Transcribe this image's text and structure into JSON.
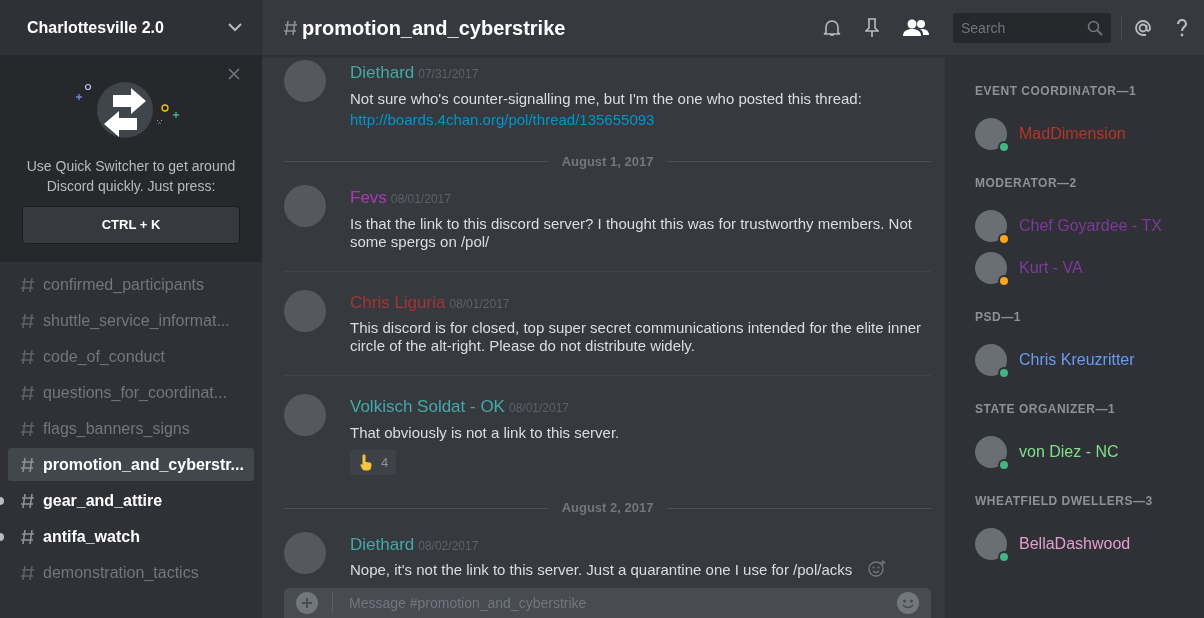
{
  "server": {
    "name": "Charlottesville 2.0"
  },
  "quick_switcher": {
    "text": "Use Quick Switcher to get around Discord quickly. Just press:",
    "shortcut": "CTRL + K"
  },
  "channels": [
    {
      "name": "confirmed_participants",
      "selected": false,
      "unread": false
    },
    {
      "name": "shuttle_service_informat...",
      "selected": false,
      "unread": false
    },
    {
      "name": "code_of_conduct",
      "selected": false,
      "unread": false
    },
    {
      "name": "questions_for_coordinat...",
      "selected": false,
      "unread": false
    },
    {
      "name": "flags_banners_signs",
      "selected": false,
      "unread": false
    },
    {
      "name": "promotion_and_cyberstr...",
      "selected": true,
      "unread": false
    },
    {
      "name": "gear_and_attire",
      "selected": false,
      "unread": true
    },
    {
      "name": "antifa_watch",
      "selected": false,
      "unread": true
    },
    {
      "name": "demonstration_tactics",
      "selected": false,
      "unread": false
    }
  ],
  "channel_header": {
    "name": "promotion_and_cyberstrike"
  },
  "search": {
    "placeholder": "Search"
  },
  "feed": [
    {
      "kind": "message",
      "author": "Diethard",
      "color": "#43a9a9",
      "timestamp": "07/31/2017",
      "text": "Not sure who's counter-signalling me, but I'm the one who posted this thread:",
      "link": "http://boards.4chan.org/pol/thread/135655093"
    },
    {
      "kind": "divider",
      "date": "August 1, 2017"
    },
    {
      "kind": "message",
      "author": "Fevs",
      "color": "#a83bb5",
      "timestamp": "08/01/2017",
      "text": "Is that the link to this discord server? I thought this was for trustworthy members. Not some spergs on /pol/"
    },
    {
      "kind": "message",
      "author": "Chris Liguria",
      "color": "#a23636",
      "timestamp": "08/01/2017",
      "text": "This discord is for closed, top super secret communications intended for the elite inner circle of the alt-right. Please do not distribute widely."
    },
    {
      "kind": "message",
      "author": "Volkisch Soldat - OK",
      "color": "#43a9a9",
      "timestamp": "08/01/2017",
      "text": "That obviously is not a link to this server.",
      "reaction": {
        "count": "4"
      }
    },
    {
      "kind": "divider",
      "date": "August 2, 2017"
    },
    {
      "kind": "message",
      "author": "Diethard",
      "color": "#43a9a9",
      "timestamp": "08/02/2017",
      "text": "Nope, it's not the link to this server. Just a quarantine one I use for /pol/acks",
      "hovered": true
    }
  ],
  "composer": {
    "placeholder": "Message #promotion_and_cyberstrike"
  },
  "members": [
    {
      "heading": "EVENT COORDINATOR—1",
      "items": [
        {
          "name": "MadDimension",
          "color": "#b3352b",
          "idle": false
        }
      ]
    },
    {
      "heading": "MODERATOR—2",
      "items": [
        {
          "name": "Chef Goyardee - TX",
          "color": "#7d3a9c",
          "idle": true
        },
        {
          "name": "Kurt - VA",
          "color": "#7d3a9c",
          "idle": true
        }
      ]
    },
    {
      "heading": "PSD—1",
      "items": [
        {
          "name": "Chris Kreuzritter",
          "color": "#6a9cf0",
          "idle": false
        }
      ]
    },
    {
      "heading": "STATE ORGANIZER—1",
      "items": [
        {
          "name": "von Diez - NC",
          "color": "#7ee08b",
          "idle": false
        }
      ]
    },
    {
      "heading": "WHEATFIELD DWELLERS—3",
      "items": [
        {
          "name": "BellaDashwood",
          "color": "#e39fd0",
          "idle": false
        }
      ]
    }
  ]
}
